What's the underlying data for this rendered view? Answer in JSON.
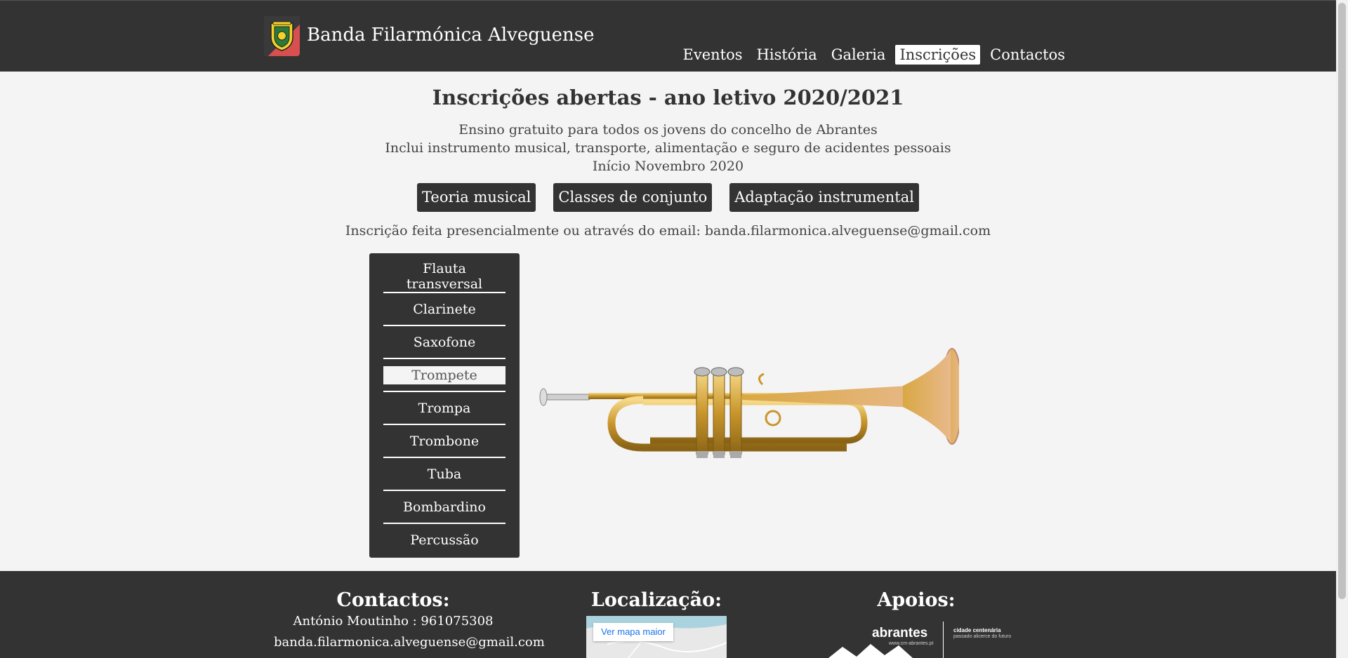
{
  "header": {
    "brand": "Banda Filarmónica Alveguense",
    "nav": [
      "Eventos",
      "História",
      "Galeria",
      "Inscrições",
      "Contactos"
    ],
    "active_nav": "Inscrições"
  },
  "main": {
    "title": "Inscrições abertas - ano letivo 2020/2021",
    "lines": [
      "Ensino gratuito para todos os jovens do concelho de Abrantes",
      "Inclui instrumento musical, transporte, alimentação e seguro de acidentes pessoais",
      "Início Novembro 2020"
    ],
    "tags": [
      "Teoria musical",
      "Classes de conjunto",
      "Adaptação instrumental"
    ],
    "email_line": "Inscrição feita presencialmente ou através do email: banda.filarmonica.alveguense@gmail.com",
    "instruments": [
      "Flauta transversal",
      "Clarinete",
      "Saxofone",
      "Trompete",
      "Trompa",
      "Trombone",
      "Tuba",
      "Bombardino",
      "Percussão"
    ],
    "active_instrument": "Trompete"
  },
  "footer": {
    "contacts_title": "Contactos:",
    "contact_phone": "António Moutinho : 961075308",
    "contact_email": "banda.filarmonica.alveguense@gmail.com",
    "location_title": "Localização:",
    "map_button": "Ver mapa maior",
    "support_title": "Apoios:",
    "sponsor_name": "abrantes",
    "sponsor_url": "www.cm-abrantes.pt",
    "sponsor_tag": "cidade centenária",
    "sponsor_tag2": "passado alicerce do futuro"
  },
  "colors": {
    "header_bg": "#333333",
    "page_bg": "#f4f4f4",
    "active_nav_bg": "#ffffff"
  }
}
